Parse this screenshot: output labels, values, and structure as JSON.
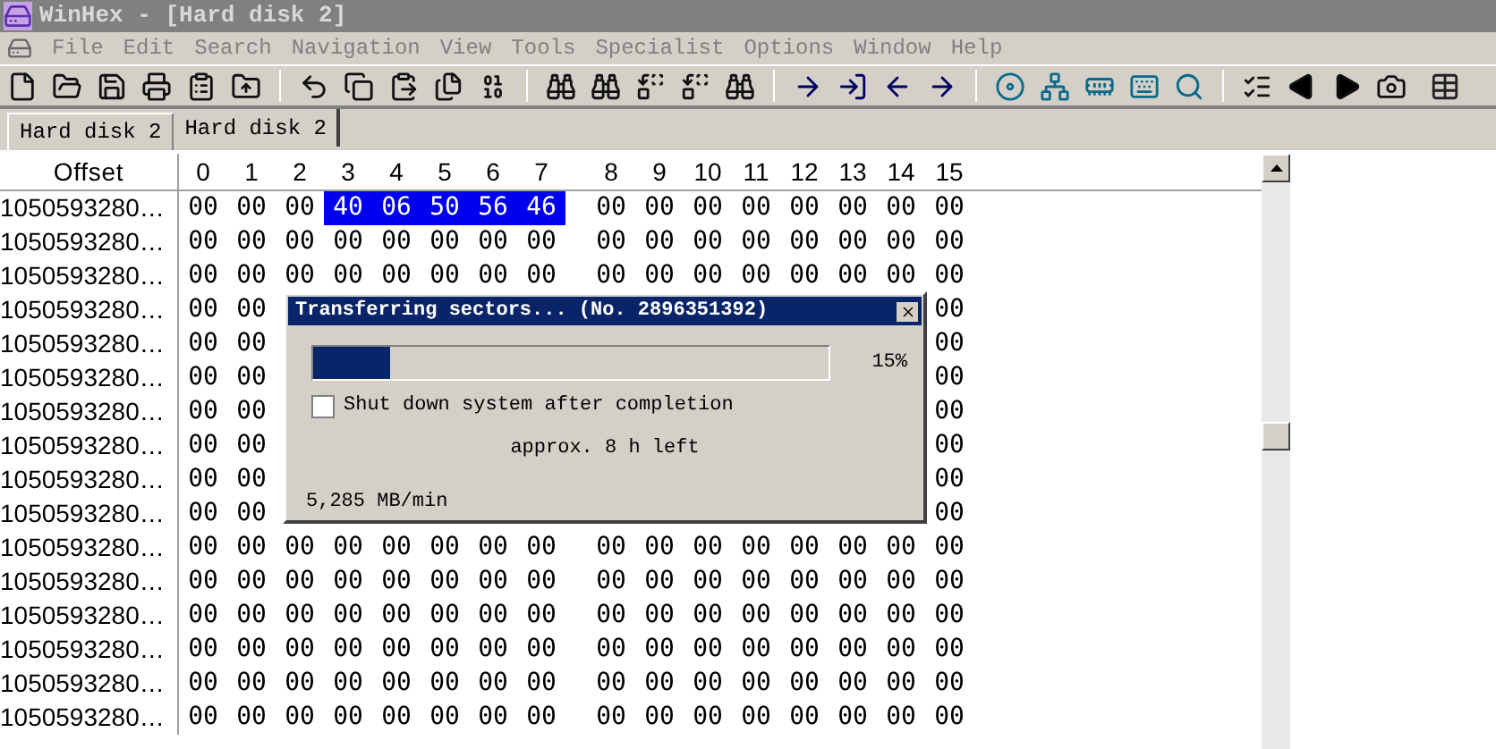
{
  "window": {
    "title": "WinHex - [Hard disk 2]"
  },
  "menu": [
    "File",
    "Edit",
    "Search",
    "Navigation",
    "View",
    "Tools",
    "Specialist",
    "Options",
    "Window",
    "Help"
  ],
  "tabs": [
    {
      "label": "Hard disk 2",
      "selected": false
    },
    {
      "label": "Hard disk 2",
      "selected": true
    }
  ],
  "grid": {
    "offset_header": "Offset",
    "columns": [
      "0",
      "1",
      "2",
      "3",
      "4",
      "5",
      "6",
      "7",
      "8",
      "9",
      "10",
      "11",
      "12",
      "13",
      "14",
      "15"
    ],
    "rows": [
      {
        "offset": "1050593280…",
        "cells": [
          {
            "v": "00",
            "selected": false
          },
          {
            "v": "00",
            "selected": false
          },
          {
            "v": "00",
            "selected": false
          },
          {
            "v": "40",
            "selected": true
          },
          {
            "v": "06",
            "selected": true
          },
          {
            "v": "50",
            "selected": true
          },
          {
            "v": "56",
            "selected": true
          },
          {
            "v": "46",
            "selected": true
          },
          {
            "v": "00",
            "selected": false
          },
          {
            "v": "00",
            "selected": false
          },
          {
            "v": "00",
            "selected": false
          },
          {
            "v": "00",
            "selected": false
          },
          {
            "v": "00",
            "selected": false
          },
          {
            "v": "00",
            "selected": false
          },
          {
            "v": "00",
            "selected": false
          },
          {
            "v": "00",
            "selected": false
          }
        ]
      },
      {
        "offset": "1050593280…",
        "cells": [
          {
            "v": "00",
            "selected": false
          },
          {
            "v": "00",
            "selected": false
          },
          {
            "v": "00",
            "selected": false
          },
          {
            "v": "00",
            "selected": false
          },
          {
            "v": "00",
            "selected": false
          },
          {
            "v": "00",
            "selected": false
          },
          {
            "v": "00",
            "selected": false
          },
          {
            "v": "00",
            "selected": false
          },
          {
            "v": "00",
            "selected": false
          },
          {
            "v": "00",
            "selected": false
          },
          {
            "v": "00",
            "selected": false
          },
          {
            "v": "00",
            "selected": false
          },
          {
            "v": "00",
            "selected": false
          },
          {
            "v": "00",
            "selected": false
          },
          {
            "v": "00",
            "selected": false
          },
          {
            "v": "00",
            "selected": false
          }
        ]
      },
      {
        "offset": "1050593280…",
        "cells": [
          {
            "v": "00",
            "selected": false
          },
          {
            "v": "00",
            "selected": false
          },
          {
            "v": "00",
            "selected": false
          },
          {
            "v": "00",
            "selected": false
          },
          {
            "v": "00",
            "selected": false
          },
          {
            "v": "00",
            "selected": false
          },
          {
            "v": "00",
            "selected": false
          },
          {
            "v": "00",
            "selected": false
          },
          {
            "v": "00",
            "selected": false
          },
          {
            "v": "00",
            "selected": false
          },
          {
            "v": "00",
            "selected": false
          },
          {
            "v": "00",
            "selected": false
          },
          {
            "v": "00",
            "selected": false
          },
          {
            "v": "00",
            "selected": false
          },
          {
            "v": "00",
            "selected": false
          },
          {
            "v": "00",
            "selected": false
          }
        ]
      },
      {
        "offset": "1050593280…",
        "cells": [
          {
            "v": "00",
            "selected": false
          },
          {
            "v": "00",
            "selected": false
          },
          null,
          null,
          null,
          null,
          null,
          null,
          null,
          null,
          null,
          null,
          null,
          null,
          null,
          {
            "v": "00",
            "selected": false
          }
        ]
      },
      {
        "offset": "1050593280…",
        "cells": [
          {
            "v": "00",
            "selected": false
          },
          {
            "v": "00",
            "selected": false
          },
          null,
          null,
          null,
          null,
          null,
          null,
          null,
          null,
          null,
          null,
          null,
          null,
          null,
          {
            "v": "00",
            "selected": false
          }
        ]
      },
      {
        "offset": "1050593280…",
        "cells": [
          {
            "v": "00",
            "selected": false
          },
          {
            "v": "00",
            "selected": false
          },
          null,
          null,
          null,
          null,
          null,
          null,
          null,
          null,
          null,
          null,
          null,
          null,
          null,
          {
            "v": "00",
            "selected": false
          }
        ]
      },
      {
        "offset": "1050593280…",
        "cells": [
          {
            "v": "00",
            "selected": false
          },
          {
            "v": "00",
            "selected": false
          },
          null,
          null,
          null,
          null,
          null,
          null,
          null,
          null,
          null,
          null,
          null,
          null,
          null,
          {
            "v": "00",
            "selected": false
          }
        ]
      },
      {
        "offset": "1050593280…",
        "cells": [
          {
            "v": "00",
            "selected": false
          },
          {
            "v": "00",
            "selected": false
          },
          null,
          null,
          null,
          null,
          null,
          null,
          null,
          null,
          null,
          null,
          null,
          null,
          null,
          {
            "v": "00",
            "selected": false
          }
        ]
      },
      {
        "offset": "1050593280…",
        "cells": [
          {
            "v": "00",
            "selected": false
          },
          {
            "v": "00",
            "selected": false
          },
          null,
          null,
          null,
          null,
          null,
          null,
          null,
          null,
          null,
          null,
          null,
          null,
          null,
          {
            "v": "00",
            "selected": false
          }
        ]
      },
      {
        "offset": "1050593280…",
        "cells": [
          {
            "v": "00",
            "selected": false
          },
          {
            "v": "00",
            "selected": false
          },
          null,
          null,
          null,
          null,
          null,
          null,
          null,
          null,
          null,
          null,
          null,
          null,
          null,
          {
            "v": "00",
            "selected": false
          }
        ]
      },
      {
        "offset": "1050593280…",
        "cells": [
          {
            "v": "00",
            "selected": false
          },
          {
            "v": "00",
            "selected": false
          },
          {
            "v": "00",
            "selected": false
          },
          {
            "v": "00",
            "selected": false
          },
          {
            "v": "00",
            "selected": false
          },
          {
            "v": "00",
            "selected": false
          },
          {
            "v": "00",
            "selected": false
          },
          {
            "v": "00",
            "selected": false
          },
          {
            "v": "00",
            "selected": false
          },
          {
            "v": "00",
            "selected": false
          },
          {
            "v": "00",
            "selected": false
          },
          {
            "v": "00",
            "selected": false
          },
          {
            "v": "00",
            "selected": false
          },
          {
            "v": "00",
            "selected": false
          },
          {
            "v": "00",
            "selected": false
          },
          {
            "v": "00",
            "selected": false
          }
        ]
      },
      {
        "offset": "1050593280…",
        "cells": [
          {
            "v": "00",
            "selected": false
          },
          {
            "v": "00",
            "selected": false
          },
          {
            "v": "00",
            "selected": false
          },
          {
            "v": "00",
            "selected": false
          },
          {
            "v": "00",
            "selected": false
          },
          {
            "v": "00",
            "selected": false
          },
          {
            "v": "00",
            "selected": false
          },
          {
            "v": "00",
            "selected": false
          },
          {
            "v": "00",
            "selected": false
          },
          {
            "v": "00",
            "selected": false
          },
          {
            "v": "00",
            "selected": false
          },
          {
            "v": "00",
            "selected": false
          },
          {
            "v": "00",
            "selected": false
          },
          {
            "v": "00",
            "selected": false
          },
          {
            "v": "00",
            "selected": false
          },
          {
            "v": "00",
            "selected": false
          }
        ]
      },
      {
        "offset": "1050593280…",
        "cells": [
          {
            "v": "00",
            "selected": false
          },
          {
            "v": "00",
            "selected": false
          },
          {
            "v": "00",
            "selected": false
          },
          {
            "v": "00",
            "selected": false
          },
          {
            "v": "00",
            "selected": false
          },
          {
            "v": "00",
            "selected": false
          },
          {
            "v": "00",
            "selected": false
          },
          {
            "v": "00",
            "selected": false
          },
          {
            "v": "00",
            "selected": false
          },
          {
            "v": "00",
            "selected": false
          },
          {
            "v": "00",
            "selected": false
          },
          {
            "v": "00",
            "selected": false
          },
          {
            "v": "00",
            "selected": false
          },
          {
            "v": "00",
            "selected": false
          },
          {
            "v": "00",
            "selected": false
          },
          {
            "v": "00",
            "selected": false
          }
        ]
      },
      {
        "offset": "1050593280…",
        "cells": [
          {
            "v": "00",
            "selected": false
          },
          {
            "v": "00",
            "selected": false
          },
          {
            "v": "00",
            "selected": false
          },
          {
            "v": "00",
            "selected": false
          },
          {
            "v": "00",
            "selected": false
          },
          {
            "v": "00",
            "selected": false
          },
          {
            "v": "00",
            "selected": false
          },
          {
            "v": "00",
            "selected": false
          },
          {
            "v": "00",
            "selected": false
          },
          {
            "v": "00",
            "selected": false
          },
          {
            "v": "00",
            "selected": false
          },
          {
            "v": "00",
            "selected": false
          },
          {
            "v": "00",
            "selected": false
          },
          {
            "v": "00",
            "selected": false
          },
          {
            "v": "00",
            "selected": false
          },
          {
            "v": "00",
            "selected": false
          }
        ]
      },
      {
        "offset": "1050593280…",
        "cells": [
          {
            "v": "00",
            "selected": false
          },
          {
            "v": "00",
            "selected": false
          },
          {
            "v": "00",
            "selected": false
          },
          {
            "v": "00",
            "selected": false
          },
          {
            "v": "00",
            "selected": false
          },
          {
            "v": "00",
            "selected": false
          },
          {
            "v": "00",
            "selected": false
          },
          {
            "v": "00",
            "selected": false
          },
          {
            "v": "00",
            "selected": false
          },
          {
            "v": "00",
            "selected": false
          },
          {
            "v": "00",
            "selected": false
          },
          {
            "v": "00",
            "selected": false
          },
          {
            "v": "00",
            "selected": false
          },
          {
            "v": "00",
            "selected": false
          },
          {
            "v": "00",
            "selected": false
          },
          {
            "v": "00",
            "selected": false
          }
        ]
      },
      {
        "offset": "1050593280…",
        "cells": [
          {
            "v": "00",
            "selected": false
          },
          {
            "v": "00",
            "selected": false
          },
          {
            "v": "00",
            "selected": false
          },
          {
            "v": "00",
            "selected": false
          },
          {
            "v": "00",
            "selected": false
          },
          {
            "v": "00",
            "selected": false
          },
          {
            "v": "00",
            "selected": false
          },
          {
            "v": "00",
            "selected": false
          },
          {
            "v": "00",
            "selected": false
          },
          {
            "v": "00",
            "selected": false
          },
          {
            "v": "00",
            "selected": false
          },
          {
            "v": "00",
            "selected": false
          },
          {
            "v": "00",
            "selected": false
          },
          {
            "v": "00",
            "selected": false
          },
          {
            "v": "00",
            "selected": false
          },
          {
            "v": "00",
            "selected": false
          }
        ]
      }
    ]
  },
  "dialog": {
    "title": "Transferring sectors... (No. 2896351392)",
    "progress": {
      "level": 0.15,
      "reading": "15%"
    },
    "checkbox": {
      "label": "Shut down system after completion",
      "checked": false
    },
    "time_left": "approx. 8 h left",
    "rate": "5,285 MB/min"
  }
}
